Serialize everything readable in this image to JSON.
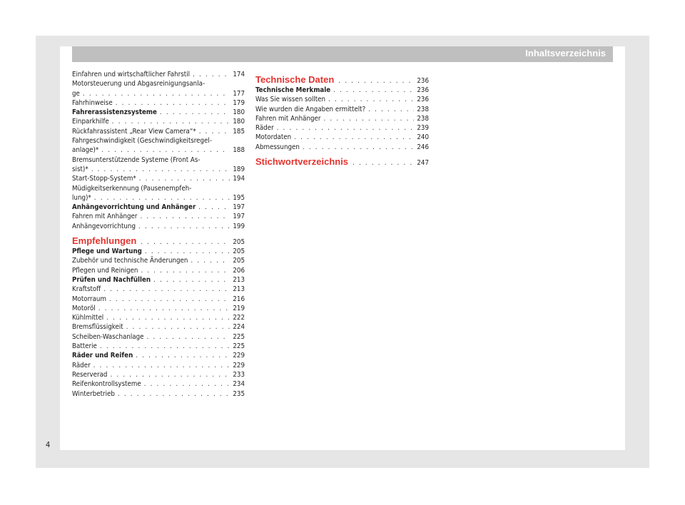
{
  "header": {
    "title": "Inhaltsverzeichnis"
  },
  "left_column": [
    {
      "lines": [
        "Einfahren und wirtschaftlicher Fahrstil"
      ],
      "page": "174",
      "bold": false
    },
    {
      "lines": [
        "Motorsteuerung und Abgasreinigungsanla-",
        "ge"
      ],
      "page": "177",
      "bold": false
    },
    {
      "lines": [
        "Fahrhinweise"
      ],
      "page": "179",
      "bold": false
    },
    {
      "lines": [
        "Fahrerassistenzsysteme"
      ],
      "page": "180",
      "bold": true
    },
    {
      "lines": [
        "Einparkhilfe"
      ],
      "page": "180",
      "bold": false
    },
    {
      "lines": [
        "Rückfahrassistent „Rear View Camera“*"
      ],
      "page": "185",
      "bold": false
    },
    {
      "lines": [
        "Fahrgeschwindigkeit (Geschwindigkeitsregel-",
        "anlage)*"
      ],
      "page": "188",
      "bold": false
    },
    {
      "lines": [
        "Bremsunterstützende Systeme (Front As-",
        "sist)*"
      ],
      "page": "189",
      "bold": false
    },
    {
      "lines": [
        "Start-Stopp-System*"
      ],
      "page": "194",
      "bold": false
    },
    {
      "lines": [
        "Müdigkeitserkennung (Pausenempfeh-",
        "lung)*"
      ],
      "page": "195",
      "bold": false
    },
    {
      "lines": [
        "Anhängevorrichtung und Anhänger"
      ],
      "page": "197",
      "bold": true
    },
    {
      "lines": [
        "Fahren mit Anhänger"
      ],
      "page": "197",
      "bold": false
    },
    {
      "lines": [
        "Anhängevorrichtung"
      ],
      "page": "199",
      "bold": false
    },
    {
      "section": true,
      "lines": [
        "Empfehlungen"
      ],
      "page": "205"
    },
    {
      "lines": [
        "Pflege und Wartung"
      ],
      "page": "205",
      "bold": true
    },
    {
      "lines": [
        "Zubehör und technische Änderungen"
      ],
      "page": "205",
      "bold": false
    },
    {
      "lines": [
        "Pflegen und Reinigen"
      ],
      "page": "206",
      "bold": false
    },
    {
      "lines": [
        "Prüfen und Nachfüllen"
      ],
      "page": "213",
      "bold": true
    },
    {
      "lines": [
        "Kraftstoff"
      ],
      "page": "213",
      "bold": false
    },
    {
      "lines": [
        "Motorraum"
      ],
      "page": "216",
      "bold": false
    },
    {
      "lines": [
        "Motoröl"
      ],
      "page": "219",
      "bold": false
    },
    {
      "lines": [
        "Kühlmittel"
      ],
      "page": "222",
      "bold": false
    },
    {
      "lines": [
        "Bremsflüssigkeit"
      ],
      "page": "224",
      "bold": false
    },
    {
      "lines": [
        "Scheiben-Waschanlage"
      ],
      "page": "225",
      "bold": false
    },
    {
      "lines": [
        "Batterie"
      ],
      "page": "225",
      "bold": false
    },
    {
      "lines": [
        "Räder und Reifen"
      ],
      "page": "229",
      "bold": true
    },
    {
      "lines": [
        "Räder"
      ],
      "page": "229",
      "bold": false
    },
    {
      "lines": [
        "Reserverad"
      ],
      "page": "233",
      "bold": false
    },
    {
      "lines": [
        "Reifenkontrollsysteme"
      ],
      "page": "234",
      "bold": false
    },
    {
      "lines": [
        "Winterbetrieb"
      ],
      "page": "235",
      "bold": false
    }
  ],
  "right_column": [
    {
      "section": true,
      "lines": [
        "Technische Daten"
      ],
      "page": "236"
    },
    {
      "lines": [
        "Technische Merkmale"
      ],
      "page": "236",
      "bold": true
    },
    {
      "lines": [
        "Was Sie wissen sollten"
      ],
      "page": "236",
      "bold": false
    },
    {
      "lines": [
        "Wie wurden die Angaben ermittelt?"
      ],
      "page": "238",
      "bold": false
    },
    {
      "lines": [
        "Fahren mit Anhänger"
      ],
      "page": "238",
      "bold": false
    },
    {
      "lines": [
        "Räder"
      ],
      "page": "239",
      "bold": false
    },
    {
      "lines": [
        "Motordaten"
      ],
      "page": "240",
      "bold": false
    },
    {
      "lines": [
        "Abmessungen"
      ],
      "page": "246",
      "bold": false
    },
    {
      "section": true,
      "lines": [
        "Stichwortverzeichnis"
      ],
      "page": "247"
    }
  ],
  "footer": {
    "page_number": "4"
  },
  "colors": {
    "accent_red": "#e3342f",
    "header_gray": "#bfbfbf",
    "frame_gray": "#e6e6e6"
  }
}
